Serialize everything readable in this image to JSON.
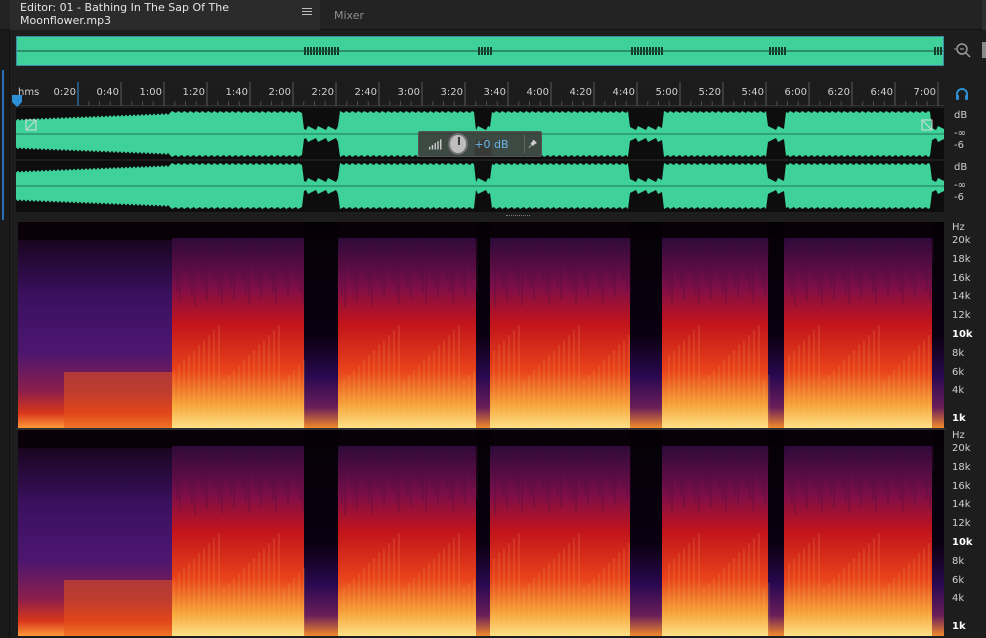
{
  "tabs": {
    "editor_label": "Editor: 01 - Bathing In The Sap Of The Moonflower.mp3",
    "mixer_label": "Mixer"
  },
  "ruler": {
    "unit": "hms",
    "labels": [
      "0:20",
      "0:40",
      "1:00",
      "1:20",
      "1:40",
      "2:00",
      "2:20",
      "2:40",
      "3:00",
      "3:20",
      "3:40",
      "4:00",
      "4:20",
      "4:40",
      "5:00",
      "5:20",
      "5:40",
      "6:00",
      "6:20",
      "6:40",
      "7:00"
    ]
  },
  "waveform": {
    "color": "#3ed29a",
    "db_unit": "dB",
    "db_ticks": [
      "-∞",
      "-6"
    ],
    "hud_value": "+0 dB"
  },
  "spectrogram": {
    "unit": "Hz",
    "ticks": [
      "20k",
      "18k",
      "16k",
      "14k",
      "12k",
      "10k",
      "8k",
      "6k",
      "4k",
      "1k"
    ],
    "bold_ticks": [
      "10k",
      "1k"
    ]
  },
  "colors": {
    "accent": "#2e8fd8",
    "waveform": "#3ed29a",
    "spectrogram_low": "#ffd966",
    "spectrogram_mid": "#d31a1a",
    "spectrogram_high": "#3a0b4a"
  }
}
